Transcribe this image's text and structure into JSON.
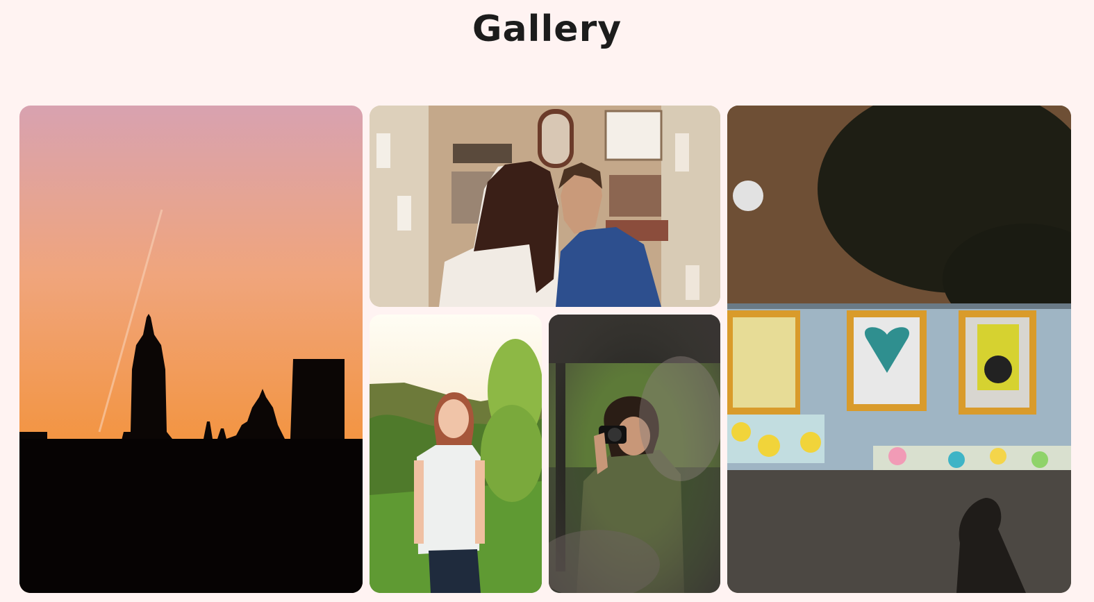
{
  "gallery": {
    "title": "Gallery",
    "photos": [
      {
        "subject": "sunset-city-silhouette",
        "alt": ""
      },
      {
        "subject": "couple-facing-building",
        "alt": ""
      },
      {
        "subject": "woman-in-garden",
        "alt": ""
      },
      {
        "subject": "man-with-camera",
        "alt": ""
      },
      {
        "subject": "painted-wall-with-windows",
        "alt": ""
      }
    ]
  },
  "colors": {
    "background": "#fff3f2",
    "title": "#1c1c1c"
  }
}
